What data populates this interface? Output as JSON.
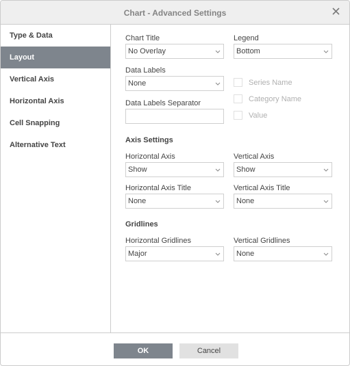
{
  "dialog": {
    "title": "Chart - Advanced Settings",
    "close_icon": "close-icon"
  },
  "sidebar": {
    "items": [
      {
        "label": "Type & Data",
        "active": false
      },
      {
        "label": "Layout",
        "active": true
      },
      {
        "label": "Vertical Axis",
        "active": false
      },
      {
        "label": "Horizontal Axis",
        "active": false
      },
      {
        "label": "Cell Snapping",
        "active": false
      },
      {
        "label": "Alternative Text",
        "active": false
      }
    ]
  },
  "layout": {
    "chart_title": {
      "label": "Chart Title",
      "value": "No Overlay"
    },
    "legend": {
      "label": "Legend",
      "value": "Bottom"
    },
    "data_labels": {
      "label": "Data Labels",
      "value": "None"
    },
    "data_labels_separator": {
      "label": "Data Labels Separator",
      "value": ""
    },
    "checkboxes": [
      {
        "label": "Series Name",
        "checked": false,
        "disabled": true
      },
      {
        "label": "Category Name",
        "checked": false,
        "disabled": true
      },
      {
        "label": "Value",
        "checked": false,
        "disabled": true
      }
    ],
    "axis_settings": {
      "heading": "Axis Settings",
      "horizontal_axis": {
        "label": "Horizontal Axis",
        "value": "Show"
      },
      "vertical_axis": {
        "label": "Vertical Axis",
        "value": "Show"
      },
      "horizontal_axis_title": {
        "label": "Horizontal Axis Title",
        "value": "None"
      },
      "vertical_axis_title": {
        "label": "Vertical Axis Title",
        "value": "None"
      }
    },
    "gridlines": {
      "heading": "Gridlines",
      "horizontal": {
        "label": "Horizontal Gridlines",
        "value": "Major"
      },
      "vertical": {
        "label": "Vertical Gridlines",
        "value": "None"
      }
    }
  },
  "footer": {
    "ok_label": "OK",
    "cancel_label": "Cancel"
  },
  "colors": {
    "accent": "#7e858d",
    "header_bg": "#efefef",
    "cancel_bg": "#e1e1e1"
  }
}
